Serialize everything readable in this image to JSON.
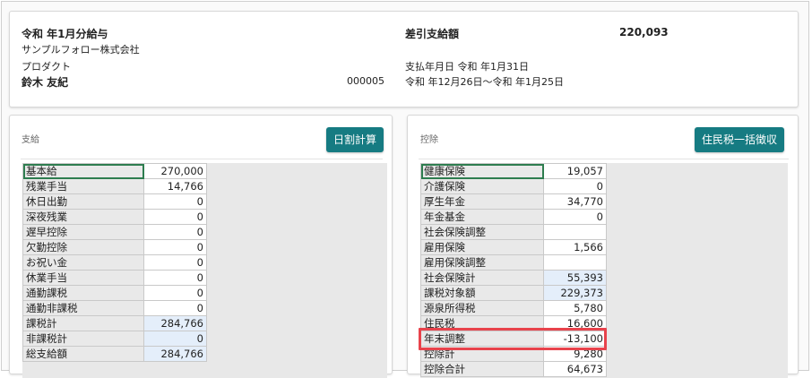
{
  "header": {
    "title": "令和 年1月分給与",
    "company": "サンプルフォロー株式会社",
    "department": "プロダクト",
    "employee_name": "鈴木 友紀",
    "employee_code": "000005",
    "net_pay_label": "差引支給額",
    "net_pay_value": "220,093",
    "pay_date": "支払年月日 令和 年1月31日",
    "period": "令和 年12月26日～令和 年1月25日"
  },
  "payments": {
    "label": "支給",
    "button": "日割計算",
    "rows": [
      {
        "label": "基本給",
        "value": "270,000"
      },
      {
        "label": "残業手当",
        "value": "14,766"
      },
      {
        "label": "休日出勤",
        "value": "0"
      },
      {
        "label": "深夜残業",
        "value": "0"
      },
      {
        "label": "遅早控除",
        "value": "0"
      },
      {
        "label": "欠勤控除",
        "value": "0"
      },
      {
        "label": "お祝い金",
        "value": "0"
      },
      {
        "label": "休業手当",
        "value": "0"
      },
      {
        "label": "通勤課税",
        "value": "0"
      },
      {
        "label": "通勤非課税",
        "value": "0"
      },
      {
        "label": "課税計",
        "value": "284,766"
      },
      {
        "label": "非課税計",
        "value": "0"
      },
      {
        "label": "総支給額",
        "value": "284,766"
      }
    ]
  },
  "deductions": {
    "label": "控除",
    "button": "住民税一括徴収",
    "rows": [
      {
        "label": "健康保険",
        "value": "19,057"
      },
      {
        "label": "介護保険",
        "value": "0"
      },
      {
        "label": "厚生年金",
        "value": "34,770"
      },
      {
        "label": "年金基金",
        "value": "0"
      },
      {
        "label": "社会保険調整",
        "value": ""
      },
      {
        "label": "雇用保険",
        "value": "1,566"
      },
      {
        "label": "雇用保険調整",
        "value": ""
      },
      {
        "label": "社会保険計",
        "value": "55,393"
      },
      {
        "label": "課税対象額",
        "value": "229,373"
      },
      {
        "label": "源泉所得税",
        "value": "5,780"
      },
      {
        "label": "住民税",
        "value": "16,600"
      },
      {
        "label": "年末調整",
        "value": "-13,100"
      },
      {
        "label": "控除計",
        "value": "9,280"
      },
      {
        "label": "控除合計",
        "value": "64,673"
      }
    ]
  },
  "colors": {
    "button": "#167b82",
    "highlight": "#e8434c",
    "selection": "#2e7d4f",
    "calc_cell": "#e4eefa"
  }
}
